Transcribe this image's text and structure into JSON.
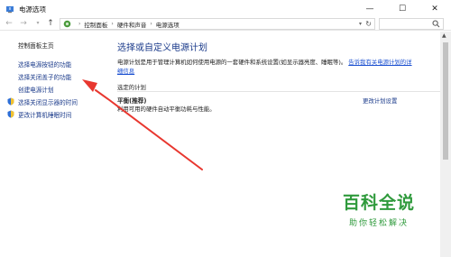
{
  "window": {
    "title": "电源选项",
    "minimize": "—",
    "maximize": "☐",
    "close": "✕"
  },
  "address": {
    "back": "←",
    "forward": "→",
    "dropdown": "▾",
    "up": "↑",
    "crumbs": [
      "控制面板",
      "硬件和声音",
      "电源选项"
    ],
    "separator": "›",
    "refresh": "↻",
    "search_placeholder": ""
  },
  "sidebar": {
    "home": "控制面板主页",
    "items": [
      {
        "label": "选择电源按钮的功能"
      },
      {
        "label": "选择关闭盖子的功能"
      },
      {
        "label": "创建电源计划"
      },
      {
        "label": "选择关闭显示器的时间"
      },
      {
        "label": "更改计算机睡眠时间"
      }
    ]
  },
  "main": {
    "heading": "选择或自定义电源计划",
    "intro_text": "电源计划是用于管理计算机如何使用电源的一套硬件和系统设置(如显示器亮度、睡眠等)。",
    "intro_link": "告诉我有关电源计划的详细信息",
    "section_label": "选定的计划",
    "plan_name": "平衡(推荐)",
    "plan_desc": "利用可用的硬件自动平衡功耗与性能。",
    "change_plan": "更改计划设置"
  },
  "watermark": {
    "big": "百科全说",
    "small": "助你轻松解决"
  },
  "colors": {
    "link": "#1a3a8a",
    "annotation_arrow": "#e8372f",
    "watermark": "#2f9a3c"
  }
}
